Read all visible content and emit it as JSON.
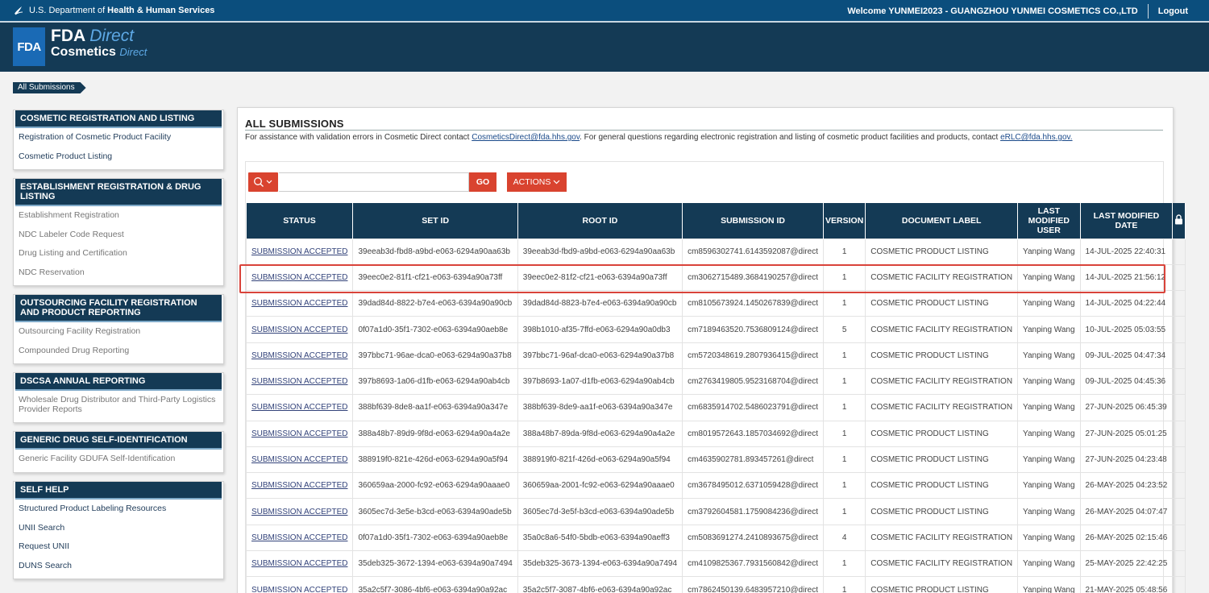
{
  "topbar": {
    "agency_prefix": "U.S. Department of",
    "agency_bold": "Health & Human Services",
    "welcome": "Welcome YUNMEI2023 - GUANGZHOU YUNMEI COSMETICS CO.,LTD",
    "logout": "Logout"
  },
  "logo": {
    "box": "FDA",
    "line1_bold": "FDA",
    "line1_italic": "Direct",
    "line2_bold": "Cosmetics",
    "line2_italic": "Direct"
  },
  "breadcrumb": "All Submissions",
  "sidebar": [
    {
      "title": "COSMETIC REGISTRATION AND LISTING",
      "items": [
        "Registration of Cosmetic Product Facility",
        "Cosmetic Product Listing"
      ],
      "style": "dark"
    },
    {
      "title": "ESTABLISHMENT REGISTRATION & DRUG LISTING",
      "items": [
        "Establishment Registration",
        "NDC Labeler Code Request",
        "Drug Listing and Certification",
        "NDC Reservation"
      ],
      "style": "grey"
    },
    {
      "title": "OUTSOURCING FACILITY REGISTRATION AND PRODUCT REPORTING",
      "items": [
        "Outsourcing Facility Registration",
        "Compounded Drug Reporting"
      ],
      "style": "grey"
    },
    {
      "title": "DSCSA ANNUAL REPORTING",
      "items": [
        "Wholesale Drug Distributor and Third-Party Logistics Provider Reports"
      ],
      "style": "grey"
    },
    {
      "title": "GENERIC DRUG SELF-IDENTIFICATION",
      "items": [
        "Generic Facility GDUFA Self-Identification"
      ],
      "style": "grey"
    },
    {
      "title": "SELF HELP",
      "items": [
        "Structured Product Labeling Resources",
        "UNII Search",
        "Request UNII",
        "DUNS Search"
      ],
      "style": "dark"
    }
  ],
  "main": {
    "title": "ALL SUBMISSIONS",
    "assist_1": "For assistance with validation errors in Cosmetic Direct contact ",
    "assist_email_1": "CosmeticsDirect@fda.hhs.gov",
    "assist_2": ". For general questions regarding electronic registration and listing of cosmetic product facilities and products, contact ",
    "assist_email_2": "eRLC@fda.hhs.gov.",
    "search_value": "",
    "go_label": "GO",
    "actions_label": "ACTIONS"
  },
  "columns": [
    "STATUS",
    "SET ID",
    "ROOT ID",
    "SUBMISSION ID",
    "VERSION",
    "DOCUMENT LABEL",
    "LAST MODIFIED USER",
    "LAST MODIFIED DATE"
  ],
  "rows": [
    [
      "SUBMISSION ACCEPTED",
      "39eeab3d-fbd8-a9bd-e063-6294a90aa63b",
      "39eeab3d-fbd9-a9bd-e063-6294a90aa63b",
      "cm8596302741.6143592087@direct",
      "1",
      "COSMETIC PRODUCT LISTING",
      "Yanping Wang",
      "14-JUL-2025 22:40:31"
    ],
    [
      "SUBMISSION ACCEPTED",
      "39eec0e2-81f1-cf21-e063-6394a90a73ff",
      "39eec0e2-81f2-cf21-e063-6394a90a73ff",
      "cm3062715489.3684190257@direct",
      "1",
      "COSMETIC FACILITY REGISTRATION",
      "Yanping Wang",
      "14-JUL-2025 21:56:12"
    ],
    [
      "SUBMISSION ACCEPTED",
      "39dad84d-8822-b7e4-e063-6394a90a90cb",
      "39dad84d-8823-b7e4-e063-6394a90a90cb",
      "cm8105673924.1450267839@direct",
      "1",
      "COSMETIC PRODUCT LISTING",
      "Yanping Wang",
      "14-JUL-2025 04:22:44"
    ],
    [
      "SUBMISSION ACCEPTED",
      "0f07a1d0-35f1-7302-e063-6394a90aeb8e",
      "398b1010-af35-7ffd-e063-6294a90a0db3",
      "cm7189463520.7536809124@direct",
      "5",
      "COSMETIC FACILITY REGISTRATION",
      "Yanping Wang",
      "10-JUL-2025 05:03:55"
    ],
    [
      "SUBMISSION ACCEPTED",
      "397bbc71-96ae-dca0-e063-6294a90a37b8",
      "397bbc71-96af-dca0-e063-6294a90a37b8",
      "cm5720348619.2807936415@direct",
      "1",
      "COSMETIC PRODUCT LISTING",
      "Yanping Wang",
      "09-JUL-2025 04:47:34"
    ],
    [
      "SUBMISSION ACCEPTED",
      "397b8693-1a06-d1fb-e063-6294a90ab4cb",
      "397b8693-1a07-d1fb-e063-6294a90ab4cb",
      "cm2763419805.9523168704@direct",
      "1",
      "COSMETIC FACILITY REGISTRATION",
      "Yanping Wang",
      "09-JUL-2025 04:45:36"
    ],
    [
      "SUBMISSION ACCEPTED",
      "388bf639-8de8-aa1f-e063-6394a90a347e",
      "388bf639-8de9-aa1f-e063-6394a90a347e",
      "cm6835914702.5486023791@direct",
      "1",
      "COSMETIC FACILITY REGISTRATION",
      "Yanping Wang",
      "27-JUN-2025 06:45:39"
    ],
    [
      "SUBMISSION ACCEPTED",
      "388a48b7-89d9-9f8d-e063-6294a90a4a2e",
      "388a48b7-89da-9f8d-e063-6294a90a4a2e",
      "cm8019572643.1857034692@direct",
      "1",
      "COSMETIC PRODUCT LISTING",
      "Yanping Wang",
      "27-JUN-2025 05:01:25"
    ],
    [
      "SUBMISSION ACCEPTED",
      "388919f0-821e-426d-e063-6294a90a5f94",
      "388919f0-821f-426d-e063-6294a90a5f94",
      "cm4635902781.893457261@direct",
      "1",
      "COSMETIC PRODUCT LISTING",
      "Yanping Wang",
      "27-JUN-2025 04:23:48"
    ],
    [
      "SUBMISSION ACCEPTED",
      "360659aa-2000-fc92-e063-6294a90aaae0",
      "360659aa-2001-fc92-e063-6294a90aaae0",
      "cm3678495012.6371059428@direct",
      "1",
      "COSMETIC PRODUCT LISTING",
      "Yanping Wang",
      "26-MAY-2025 04:23:52"
    ],
    [
      "SUBMISSION ACCEPTED",
      "3605ec7d-3e5e-b3cd-e063-6394a90ade5b",
      "3605ec7d-3e5f-b3cd-e063-6394a90ade5b",
      "cm3792604581.1759084236@direct",
      "1",
      "COSMETIC PRODUCT LISTING",
      "Yanping Wang",
      "26-MAY-2025 04:07:47"
    ],
    [
      "SUBMISSION ACCEPTED",
      "0f07a1d0-35f1-7302-e063-6394a90aeb8e",
      "35a0c8a6-54f0-5bdb-e063-6394a90aeff3",
      "cm5083691274.2410893675@direct",
      "4",
      "COSMETIC FACILITY REGISTRATION",
      "Yanping Wang",
      "26-MAY-2025 02:15:46"
    ],
    [
      "SUBMISSION ACCEPTED",
      "35deb325-3672-1394-e063-6394a90a7494",
      "35deb325-3673-1394-e063-6394a90a7494",
      "cm4109825367.7931560842@direct",
      "1",
      "COSMETIC FACILITY REGISTRATION",
      "Yanping Wang",
      "25-MAY-2025 22:42:25"
    ],
    [
      "SUBMISSION ACCEPTED",
      "35a2c5f7-3086-4bf6-e063-6394a90a92ac",
      "35a2c5f7-3087-4bf6-e063-6394a90a92ac",
      "cm7862450139.6483957210@direct",
      "1",
      "COSMETIC PRODUCT LISTING",
      "Yanping Wang",
      "21-MAY-2025 05:48:56"
    ]
  ],
  "colors": {
    "navy": "#143a55",
    "top_blue": "#0b4e7d",
    "accent_red": "#d9432f",
    "highlight_red": "#d9433a"
  },
  "icons": {
    "hhs": "hhs-eagle-icon",
    "search": "search-icon",
    "lock": "lock-icon",
    "chevron": "chevron-down-icon"
  }
}
